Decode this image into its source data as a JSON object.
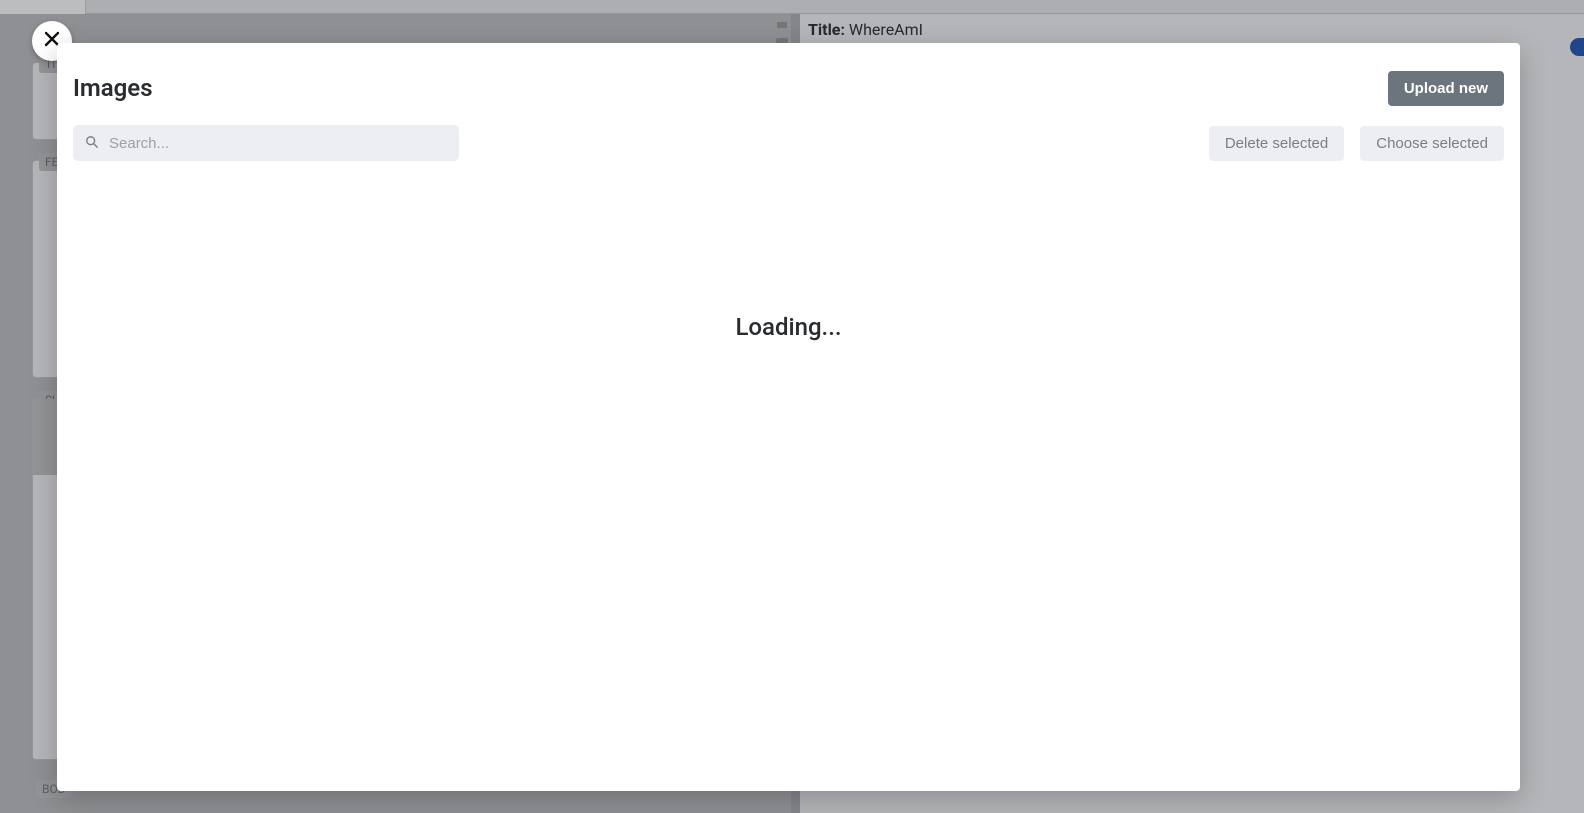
{
  "background": {
    "right_title_label": "Title:",
    "right_title_value": "WhereAmI",
    "panels": {
      "title": "TI",
      "fea": "FEA",
      "sub": "SU",
      "body": "BOD"
    }
  },
  "modal": {
    "title": "Images",
    "upload_label": "Upload new",
    "search_placeholder": "Search...",
    "delete_label": "Delete selected",
    "choose_label": "Choose selected",
    "loading_text": "Loading..."
  }
}
